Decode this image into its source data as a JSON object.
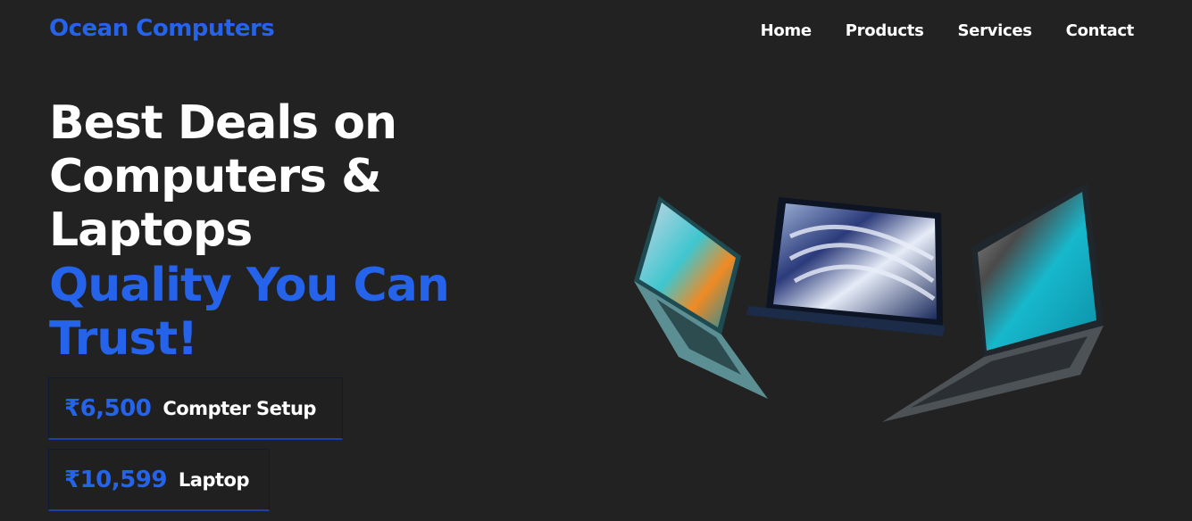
{
  "header": {
    "logo": "Ocean Computers",
    "nav": [
      "Home",
      "Products",
      "Services",
      "Contact"
    ]
  },
  "hero": {
    "headline": [
      "Best Deals on",
      "Computers &",
      "Laptops"
    ],
    "tagline": [
      "Quality You Can",
      "Trust!"
    ]
  },
  "offers": [
    {
      "price": "₹6,500",
      "label": "Compter Setup"
    },
    {
      "price": "₹10,599",
      "label": "Laptop"
    }
  ],
  "colors": {
    "background": "#222222",
    "accent": "#2563eb",
    "text": "#ffffff"
  },
  "illustration": {
    "icon": "laptops-image"
  }
}
